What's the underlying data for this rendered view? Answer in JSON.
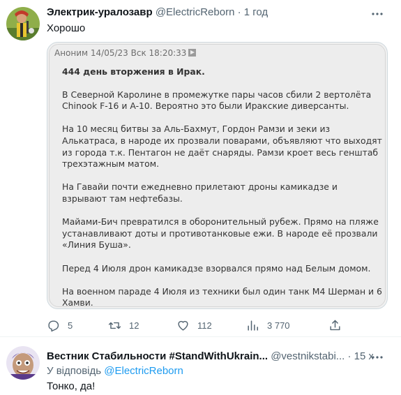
{
  "tweet1": {
    "author_name": "Электрик-уралозавр",
    "handle": "@ElectricReborn",
    "separator": "·",
    "time": "1 год",
    "text": "Хорошо",
    "post": {
      "meta": "Аноним 14/05/23 Вск 18:20:33",
      "headline": "444 день вторжения в Ирак.",
      "paragraphs": [
        "В Северной Каролине в промежутке пары часов сбили 2 вертолёта Chinook F-16 и A-10. Вероятно это были Иракские диверсанты.",
        "На 10 месяц битвы за Аль-Бахмут, Гордон Рамзи и зеки из Алькатраса, в народе их прозвали поварами, объявляют что выходят из города т.к. Пентагон не даёт снаряды. Рамзи кроет весь генштаб трехэтажным матом.",
        "На Гавайи почти ежедневно прилетают дроны камикадзе и взрывают там нефтебазы.",
        "Майами-Бич превратился в оборонительный рубеж. Прямо на пляже устанавливают доты и противотанковые ежи. В народе её прозвали «Линия Буша».",
        "Перед 4 Июля дрон камикадзе взорвался прямо над Белым домом.",
        "На военном параде 4 Июля из техники был один танк М4 Шерман и 6 Хамви."
      ]
    },
    "actions": {
      "replies": "5",
      "retweets": "12",
      "likes": "112",
      "views": "3 770"
    }
  },
  "tweet2": {
    "author_name": "Вестник Стабильности #StandWithUkrain...",
    "handle": "@vestnikstabi...",
    "separator": "·",
    "time": "15 хв",
    "reply_prefix": "У відповідь",
    "reply_mention": "@ElectricReborn",
    "text": "Тонко, да!"
  },
  "icons": {
    "more": "more-icon",
    "reply": "reply-icon",
    "retweet": "retweet-icon",
    "like": "heart-icon",
    "views": "views-icon",
    "share": "share-icon",
    "play": "play-icon"
  },
  "colors": {
    "secondary_text": "#536471",
    "link": "#1d9bf0",
    "border": "#cfd9de"
  }
}
